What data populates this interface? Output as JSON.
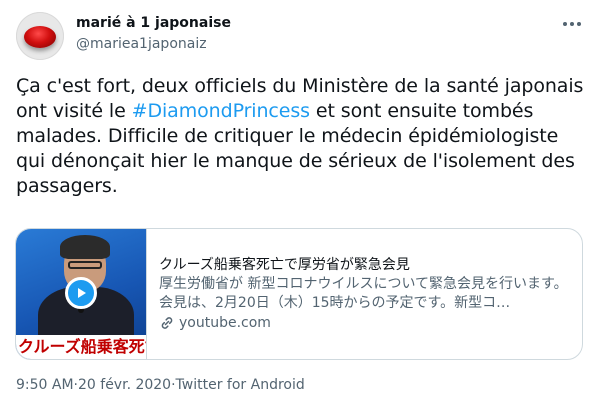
{
  "author": {
    "name": "marié à 1 japonaise",
    "handle": "@mariea1japonaiz"
  },
  "more_icon": "more-horizontal-icon",
  "tweet": {
    "text_before": "Ça c'est fort, deux officiels du Ministère de la santé japonais ont visité le ",
    "hashtag": "#DiamondPrincess",
    "text_after": " et sont ensuite tombés malades. Difficile de critiquer le médecin épidémiologiste qui dénonçait hier le manque de sérieux de l'isolement des passagers."
  },
  "card": {
    "thumbnail_banner": "クルーズ船乗客死亡で",
    "title": "クルーズ船乗客死亡で厚労省が緊急会見",
    "description": "厚生労働省が 新型コロナウイルスについて緊急会見を行います。会見は、2月20日（木）15時からの予定です。新型コ…",
    "domain": "youtube.com",
    "domain_icon": "link-icon",
    "play_icon": "play-icon"
  },
  "meta": {
    "time": "9:50 AM",
    "separator": " · ",
    "date": "20 févr. 2020",
    "source": "Twitter for Android"
  },
  "colors": {
    "accent": "#1d9bf0",
    "secondary_text": "#536471",
    "border": "#cfd9de"
  }
}
